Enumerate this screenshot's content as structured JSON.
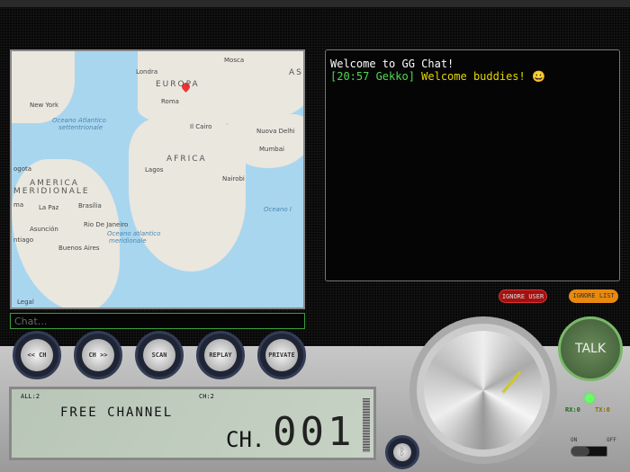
{
  "map": {
    "labels": {
      "mosca": "Mosca",
      "londra": "Londra",
      "europa": "EUROPA",
      "asia": "AS",
      "newyork": "New York",
      "roma": "Roma",
      "oas1": "Oceano Atlantico",
      "oas2": "settentrionale",
      "cairo": "Il Cairo",
      "delhi": "Nuova Delhi",
      "mumbai": "Mumbai",
      "africa": "AFRICA",
      "lagos": "Lagos",
      "nairobi": "Nairobi",
      "oi": "Oceano I",
      "bogota": "ogota",
      "am1": "AMERICA",
      "am2": "MERIDIONALE",
      "lima": "ma",
      "lapaz": "La Paz",
      "brasilia": "Brasília",
      "rio": "Rio De Janeiro",
      "asuncion": "Asunción",
      "santiago": "ntiago",
      "oam1": "Oceano atlantico",
      "oam2": "meridionale",
      "ba": "Buenos Aires",
      "legal": "Legal"
    }
  },
  "chat": {
    "welcome": "Welcome to GG Chat!",
    "messages": [
      {
        "time": "[20:57 Gekko]",
        "text": "Welcome buddies! 😀"
      }
    ],
    "placeholder": "Chat..."
  },
  "buttons": {
    "ignore_user": "IGNORE USER",
    "ignore_list": "IGNORE LIST",
    "prev": "<< CH",
    "next": "CH >>",
    "scan": "SCAN",
    "replay": "REPLAY",
    "private": "PRIVATE",
    "talk": "TALK"
  },
  "lcd": {
    "all": "ALL:2",
    "ch": "CH:2",
    "channel_name": "FREE CHANNEL",
    "ch_label": "CH.",
    "number": "001"
  },
  "status": {
    "rx": "RX:0",
    "tx": "TX:0",
    "on": "ON",
    "off": "OFF"
  },
  "colors": {
    "ignore_user": "#b01010",
    "ignore_list": "#e88a10"
  }
}
